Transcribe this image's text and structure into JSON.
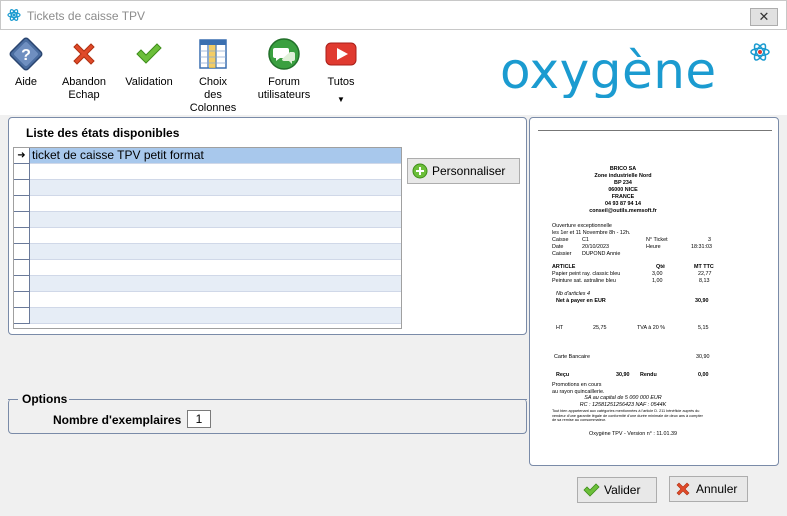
{
  "window": {
    "title": "Tickets de caisse TPV"
  },
  "toolbar": {
    "aide": "Aide",
    "abandon_1": "Abandon",
    "abandon_2": "Echap",
    "validation": "Validation",
    "colonnes_1": "Choix",
    "colonnes_2": "des",
    "colonnes_3": "Colonnes",
    "forum_1": "Forum",
    "forum_2": "utilisateurs",
    "tutos": "Tutos"
  },
  "logo": {
    "text": "oxygène"
  },
  "list": {
    "heading": "Liste des états disponibles",
    "rows": [
      "ticket de caisse TPV petit format",
      "",
      "",
      "",
      "",
      "",
      "",
      "",
      "",
      "",
      ""
    ]
  },
  "buttons": {
    "personnaliser": "Personnaliser",
    "valider": "Valider",
    "annuler": "Annuler"
  },
  "options": {
    "title": "Options",
    "copies_label": "Nombre d'exemplaires",
    "copies_value": "1"
  },
  "receipt": {
    "shop_name": "BRICO SA",
    "address1": "Zone industrielle Nord",
    "address2": "BP 234",
    "city": "06000 NICE",
    "country": "FRANCE",
    "phone": "04 93 87 94 14",
    "email": "conseil@outils.memsoft.fr",
    "notice1": "Ouverture exceptionnelle",
    "notice2": "les 1er et 11 Novembre 8h - 12h.",
    "caisse_label": "Caisse",
    "caisse_value": "C1",
    "ticket_label": "N° Ticket",
    "ticket_value": "3",
    "date_label": "Date",
    "date_value": "20/10/2023",
    "heure_label": "Heure",
    "heure_value": "18:31:03",
    "caissier_label": "Caissier",
    "caissier_value": "DUPOND Annie",
    "col_article": "ARTICLE",
    "col_qty": "Qté",
    "col_mt": "MT TTC",
    "items": [
      {
        "name": "Papier peint ray. classic bleu",
        "qty": "3,00",
        "mt": "22,77"
      },
      {
        "name": "Peinture sat. astraline bleu",
        "qty": "1,00",
        "mt": "8,13"
      }
    ],
    "nb_articles": "Nb d'articles  4",
    "net_label": "Net à payer en EUR",
    "net_value": "30,90",
    "ht_label": "HT",
    "ht_value": "25,75",
    "tva_label": "TVA à 20 %",
    "tva_value": "5,15",
    "payment_label": "Carte Bancaire",
    "payment_value": "30,90",
    "recu_label": "Reçu",
    "recu_value": "30,90",
    "rendu_label": "Rendu",
    "rendu_value": "0,00",
    "promo1": "Promotions en cours",
    "promo2": "au rayon quincaillerie.",
    "capital": "SA au capital de 5 000 000 EUR",
    "rc": "RC : 12581251256423  NAF : 0544K",
    "legal1": "Tout bien appartenant aux catégories mentionnées à l'article D. 211 bénéficie auprès du",
    "legal2": "vendeur d'une garantie légale de conformité d'une durée minimale de deux ans à compter",
    "legal3": "de sa remise au consommateur.",
    "version": "Oxygène TPV - Version n° : 11.01.39"
  },
  "colors": {
    "accent": "#1b9bd0",
    "selection": "#a8c8ec",
    "alt_row": "#e6edf6"
  }
}
